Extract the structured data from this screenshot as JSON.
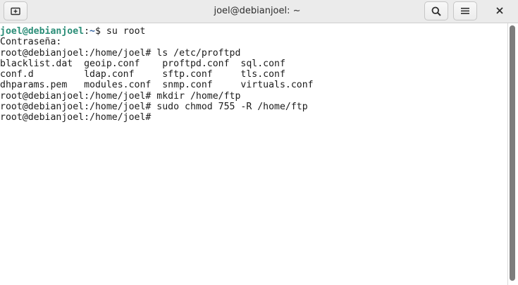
{
  "window": {
    "title": "joel@debianjoel: ~"
  },
  "headerbar": {
    "new_tab_icon": "new-tab-icon",
    "search_icon": "search-icon",
    "menu_icon": "hamburger-menu-icon",
    "close_icon": "close-icon",
    "close_glyph": "✕"
  },
  "terminal": {
    "line1": {
      "user": "joel@debianjoel",
      "sep": ":",
      "path": "~",
      "cmd": "$ su root"
    },
    "line2": "Contraseña:",
    "line3": "root@debianjoel:/home/joel# ls /etc/proftpd",
    "line4": "blacklist.dat  geoip.conf    proftpd.conf  sql.conf",
    "line5": "conf.d         ldap.conf     sftp.conf     tls.conf",
    "line6": "dhparams.pem   modules.conf  snmp.conf     virtuals.conf",
    "line7": "root@debianjoel:/home/joel# mkdir /home/ftp",
    "line8": "root@debianjoel:/home/joel# sudo chmod 755 -R /home/ftp",
    "line9": "root@debianjoel:/home/joel# "
  },
  "colors": {
    "prompt_user": "#2a8d77",
    "prompt_path": "#3465a4",
    "headerbar_bg": "#ebebeb"
  }
}
